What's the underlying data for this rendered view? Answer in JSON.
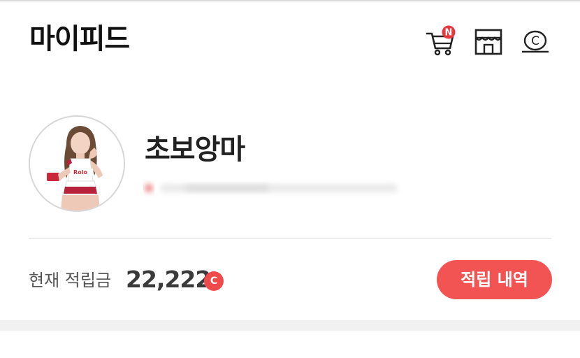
{
  "header": {
    "title": "마이피드",
    "cart_badge": "N",
    "coin_icon_text": "C"
  },
  "profile": {
    "nickname": "초보앙마"
  },
  "points": {
    "label": "현재 적립금",
    "value": "22,222",
    "coin_symbol": "C",
    "history_button_label": "적립 내역"
  },
  "colors": {
    "accent": "#f25454",
    "badge": "#e8383d",
    "title_text": "#111111"
  },
  "icons": [
    "cart-icon",
    "store-icon",
    "coin-icon",
    "coin-badge-icon"
  ]
}
